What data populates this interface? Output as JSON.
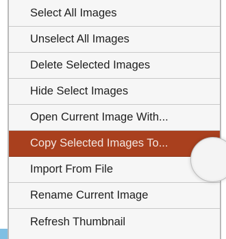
{
  "menu": {
    "items": [
      {
        "label": "Select All Images"
      },
      {
        "label": "Unselect All Images"
      },
      {
        "label": "Delete Selected Images"
      },
      {
        "label": "Hide Select Images"
      },
      {
        "label": "Open Current Image With..."
      },
      {
        "label": "Copy Selected Images To...",
        "highlighted": true
      },
      {
        "label": "Import From File"
      },
      {
        "label": "Rename Current Image"
      },
      {
        "label": "Refresh Thumbnail"
      }
    ]
  },
  "colors": {
    "highlight": "#a9401e",
    "menu_background": "#f6f6f6",
    "text": "#1e1e1e"
  }
}
